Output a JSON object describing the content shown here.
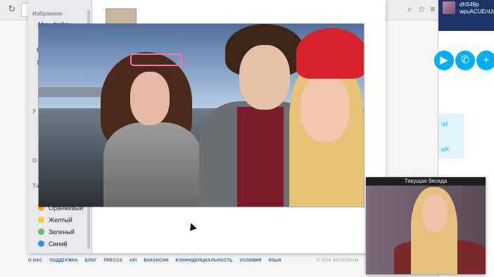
{
  "finder": {
    "section_favorites": "Избранное",
    "favorites_first": "Мои файлы",
    "sidebar_partial_labels": [
      "С",
      "Ж",
      "У",
      "О"
    ],
    "tags_partial": "Ти",
    "tags": [
      {
        "label": "Оранжевый",
        "color": "#f5a623"
      },
      {
        "label": "Желтый",
        "color": "#f5d033"
      },
      {
        "label": "Зеленый",
        "color": "#5cc05a"
      },
      {
        "label": "Синий",
        "color": "#3b8de0"
      }
    ]
  },
  "instagram_footer": {
    "links": [
      "О НАС",
      "ПОДДЕРЖКА",
      "БЛОГ",
      "ПРЕССА",
      "API",
      "ВАКАНСИИ",
      "КОНФИДЕНЦИАЛЬНОСТЬ",
      "УСЛОВИЯ",
      "ЯЗЫК"
    ],
    "copyright": "© 2016 INSTAGRAM"
  },
  "skype": {
    "user_line1": "dhS49p",
    "user_line2": "wpuACUEnUwY",
    "snippet1": "ud",
    "snippet2": "wX"
  },
  "webcam": {
    "title": "Текущая беседа"
  }
}
